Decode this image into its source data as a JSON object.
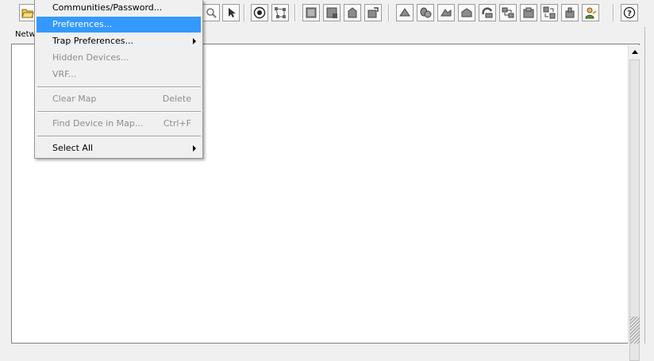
{
  "panel": {
    "label": "Netw"
  },
  "menu": {
    "items": [
      {
        "label": "Communities/Password...",
        "state": "normal"
      },
      {
        "label": "Preferences...",
        "state": "selected"
      },
      {
        "label": "Trap Preferences...",
        "state": "normal",
        "submenu": true
      },
      {
        "label": "Hidden Devices...",
        "state": "disabled"
      },
      {
        "label": "VRF...",
        "state": "disabled"
      },
      {
        "label": "Clear Map",
        "shortcut": "Delete",
        "state": "disabled"
      },
      {
        "label": "Find Device in Map...",
        "shortcut": "Ctrl+F",
        "state": "disabled"
      },
      {
        "label": "Select All",
        "state": "normal",
        "submenu": true
      }
    ]
  },
  "toolbar": {
    "icons": [
      "open-folder-icon",
      "zoom-icon",
      "pointer-icon",
      "device-group-icon",
      "topology-icon",
      "device-icon-1",
      "device-icon-2",
      "device-icon-3",
      "device-icon-4",
      "network-icon-1",
      "network-icon-2",
      "network-icon-3",
      "network-icon-4",
      "network-icon-5",
      "network-icon-6",
      "network-icon-7",
      "network-icon-8",
      "network-icon-9",
      "user-icon",
      "help-icon"
    ]
  },
  "colors": {
    "selection": "#3399ff",
    "disabled_text": "#8d8d8d",
    "background": "#f0f0f0"
  }
}
